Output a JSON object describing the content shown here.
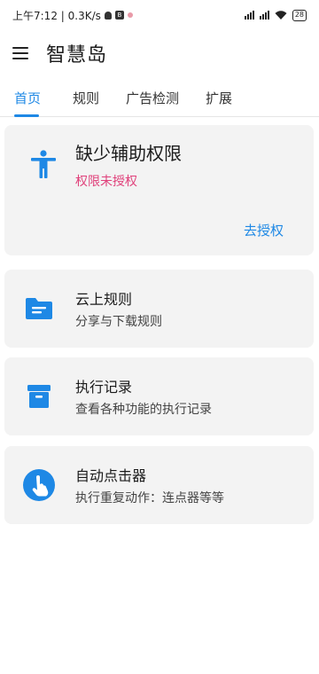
{
  "status_bar": {
    "time_speed": "上午7:12 | 0.3K/s",
    "app_icon_letter": "B",
    "signal1_label": "HD",
    "signal2_label": "HD",
    "battery": "28"
  },
  "app_bar": {
    "title": "智慧岛",
    "menu_icon": "menu-icon"
  },
  "tabs": [
    {
      "label": "首页",
      "active": true
    },
    {
      "label": "规则",
      "active": false
    },
    {
      "label": "广告检测",
      "active": false
    },
    {
      "label": "扩展",
      "active": false
    }
  ],
  "permission_card": {
    "icon": "accessibility-icon",
    "title": "缺少辅助权限",
    "subtitle": "权限未授权",
    "action": "去授权"
  },
  "cards": [
    {
      "icon": "folder-icon",
      "title": "云上规则",
      "subtitle": "分享与下载规则"
    },
    {
      "icon": "archive-icon",
      "title": "执行记录",
      "subtitle": "查看各种功能的执行记录"
    },
    {
      "icon": "touch-icon",
      "title": "自动点击器",
      "subtitle": "执行重复动作：连点器等等"
    }
  ],
  "colors": {
    "accent": "#1e88e5",
    "warning": "#e0407a",
    "card_bg": "#f3f3f3"
  }
}
